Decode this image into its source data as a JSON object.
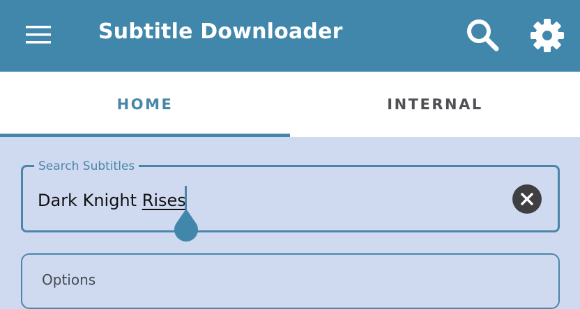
{
  "app_bar": {
    "title": "Subtitle Downloader",
    "background": "#4187ac",
    "icons": [
      "menu-icon",
      "search-icon",
      "gear-icon"
    ]
  },
  "tabs": [
    {
      "label": "HOME",
      "selected": true
    },
    {
      "label": "INTERNAL",
      "selected": false
    }
  ],
  "search": {
    "label": "Search Subtitles",
    "value_plain": "Dark Knight ",
    "value_underlined": "Rises",
    "clear_icon": "close-icon"
  },
  "options": {
    "label": "Options"
  },
  "colors": {
    "accent": "#4187ac",
    "content_background": "#cfdaf0"
  }
}
